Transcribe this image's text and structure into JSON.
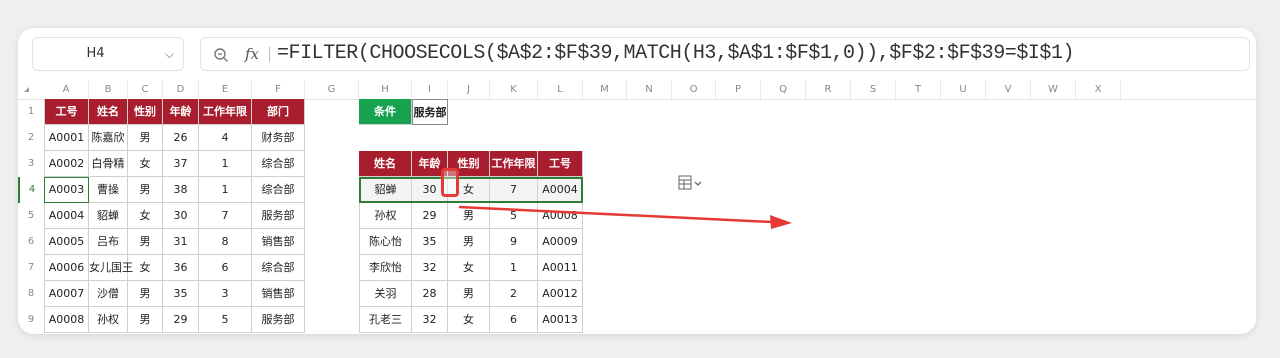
{
  "namebox": {
    "value": "H4",
    "arrow": "⌵"
  },
  "formula": {
    "zoom_icon": "zoom-icon",
    "fx_label": "fx",
    "text": "=FILTER(CHOOSECOLS($A$2:$F$39,MATCH(H3,$A$1:$F$1,0)),$F$2:$F$39=$I$1)"
  },
  "columns": [
    "A",
    "B",
    "C",
    "D",
    "E",
    "F",
    "G",
    "H",
    "I",
    "J",
    "K",
    "L",
    "M",
    "N",
    "O",
    "P",
    "Q",
    "R",
    "S",
    "T",
    "U",
    "V",
    "W",
    "X"
  ],
  "rows": [
    "1",
    "2",
    "3",
    "4",
    "5",
    "6",
    "7",
    "8",
    "9"
  ],
  "left_table": {
    "headers": [
      "工号",
      "姓名",
      "性别",
      "年龄",
      "工作年限",
      "部门"
    ],
    "data": [
      [
        "A0001",
        "陈嘉欣",
        "男",
        "26",
        "4",
        "财务部"
      ],
      [
        "A0002",
        "白骨精",
        "女",
        "37",
        "1",
        "综合部"
      ],
      [
        "A0003",
        "曹操",
        "男",
        "38",
        "1",
        "综合部"
      ],
      [
        "A0004",
        "貂蝉",
        "女",
        "30",
        "7",
        "服务部"
      ],
      [
        "A0005",
        "吕布",
        "男",
        "31",
        "8",
        "销售部"
      ],
      [
        "A0006",
        "女儿国王",
        "女",
        "36",
        "6",
        "综合部"
      ],
      [
        "A0007",
        "沙僧",
        "男",
        "35",
        "3",
        "销售部"
      ],
      [
        "A0008",
        "孙权",
        "男",
        "29",
        "5",
        "服务部"
      ]
    ]
  },
  "condition": {
    "label": "条件",
    "value": "服务部"
  },
  "right_table": {
    "headers": [
      "姓名",
      "年龄",
      "性别",
      "工作年限",
      "工号"
    ],
    "data": [
      [
        "貂蝉",
        "30",
        "女",
        "7",
        "A0004"
      ],
      [
        "孙权",
        "29",
        "男",
        "5",
        "A0008"
      ],
      [
        "陈心怡",
        "35",
        "男",
        "9",
        "A0009"
      ],
      [
        "李欣怡",
        "32",
        "女",
        "1",
        "A0011"
      ],
      [
        "关羽",
        "28",
        "男",
        "2",
        "A0012"
      ],
      [
        "孔老三",
        "32",
        "女",
        "6",
        "A0013"
      ]
    ]
  },
  "colors": {
    "header_red": "#a81e2f",
    "condition_green": "#16a24e",
    "annotation_red": "#e53935"
  }
}
